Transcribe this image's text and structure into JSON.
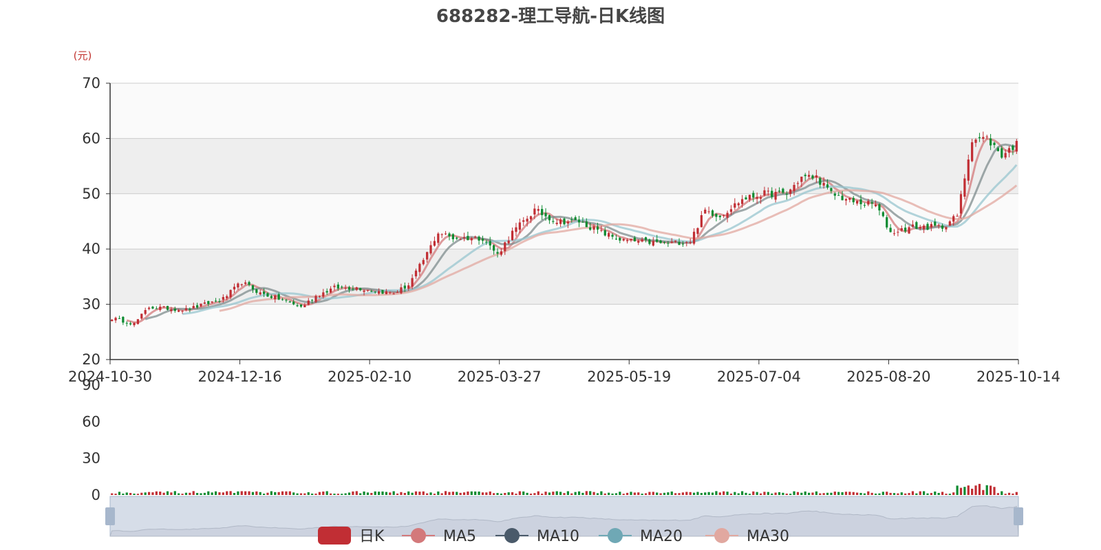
{
  "title": "688282-理工导航-日K线图",
  "colors": {
    "up": "#c12e34",
    "down": "#0e8b31",
    "ma5": "#d3797b",
    "ma10": "#7f8c8d",
    "ma20": "#98c6cf",
    "ma30": "#e1a8a0",
    "band_dark": "#eeeeee",
    "band_light": "#fafafa",
    "grid": "#cccccc",
    "axis": "#333333",
    "slider_fill": "#d6dde8",
    "slider_handle": "#a7b7cc"
  },
  "chart_data": {
    "type": "candlestick",
    "title": "688282-理工导航-日K线图",
    "y_unit": "(元)",
    "ylim": [
      20,
      70
    ],
    "yticks": [
      20,
      30,
      40,
      50,
      60,
      70
    ],
    "volume_ylim": [
      0,
      90
    ],
    "volume_yticks": [
      0,
      30,
      60,
      90
    ],
    "x_tick_labels": [
      "2024-10-30",
      "2024-12-16",
      "2025-02-10",
      "2025-03-27",
      "2025-05-19",
      "2025-07-04",
      "2025-08-20",
      "2025-10-14"
    ],
    "grid": true,
    "legend_position": "bottom-center",
    "legend": [
      "日K",
      "MA5",
      "MA10",
      "MA20",
      "MA30"
    ],
    "close_anchors": [
      [
        0,
        27.5
      ],
      [
        6,
        26.5
      ],
      [
        10,
        29.5
      ],
      [
        20,
        29.0
      ],
      [
        25,
        30.0
      ],
      [
        30,
        31.0
      ],
      [
        35,
        34.0
      ],
      [
        40,
        32.0
      ],
      [
        45,
        31.0
      ],
      [
        51,
        29.5
      ],
      [
        55,
        31.5
      ],
      [
        60,
        33.0
      ],
      [
        66,
        33.0
      ],
      [
        70,
        32.5
      ],
      [
        76,
        32.0
      ],
      [
        80,
        33.5
      ],
      [
        84,
        38.0
      ],
      [
        88,
        43.0
      ],
      [
        92,
        42.0
      ],
      [
        100,
        42.0
      ],
      [
        104,
        39.0
      ],
      [
        108,
        43.0
      ],
      [
        114,
        47.0
      ],
      [
        120,
        45.0
      ],
      [
        126,
        45.0
      ],
      [
        132,
        43.0
      ],
      [
        138,
        41.5
      ],
      [
        150,
        41.0
      ],
      [
        156,
        41.5
      ],
      [
        160,
        47.0
      ],
      [
        164,
        46.0
      ],
      [
        170,
        49.0
      ],
      [
        176,
        50.0
      ],
      [
        182,
        50.0
      ],
      [
        186,
        53.0
      ],
      [
        190,
        53.0
      ],
      [
        194,
        50.0
      ],
      [
        200,
        48.5
      ],
      [
        206,
        48.0
      ],
      [
        210,
        43.0
      ],
      [
        216,
        44.0
      ],
      [
        224,
        44.0
      ],
      [
        228,
        46.0
      ],
      [
        232,
        60.0
      ],
      [
        236,
        60.0
      ],
      [
        240,
        57.0
      ],
      [
        244,
        59.0
      ]
    ]
  },
  "slider": {
    "start_pct": 0,
    "end_pct": 100
  }
}
